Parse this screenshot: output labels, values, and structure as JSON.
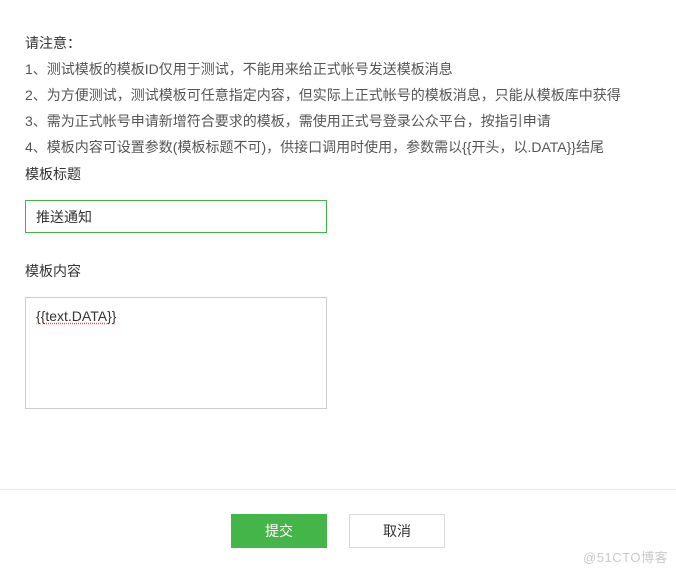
{
  "notice": {
    "heading": "请注意：",
    "lines": [
      "1、测试模板的模板ID仅用于测试，不能用来给正式帐号发送模板消息",
      "2、为方便测试，测试模板可任意指定内容，但实际上正式帐号的模板消息，只能从模板库中获得",
      "3、需为正式帐号申请新增符合要求的模板，需使用正式号登录公众平台，按指引申请",
      "4、模板内容可设置参数(模板标题不可)，供接口调用时使用，参数需以{{开头，以.DATA}}结尾"
    ]
  },
  "fields": {
    "title_label": "模板标题",
    "title_value": "推送通知",
    "content_label": "模板内容",
    "content_value": "{{text.DATA}}"
  },
  "buttons": {
    "submit": "提交",
    "cancel": "取消"
  },
  "watermark": "@51CTO博客"
}
